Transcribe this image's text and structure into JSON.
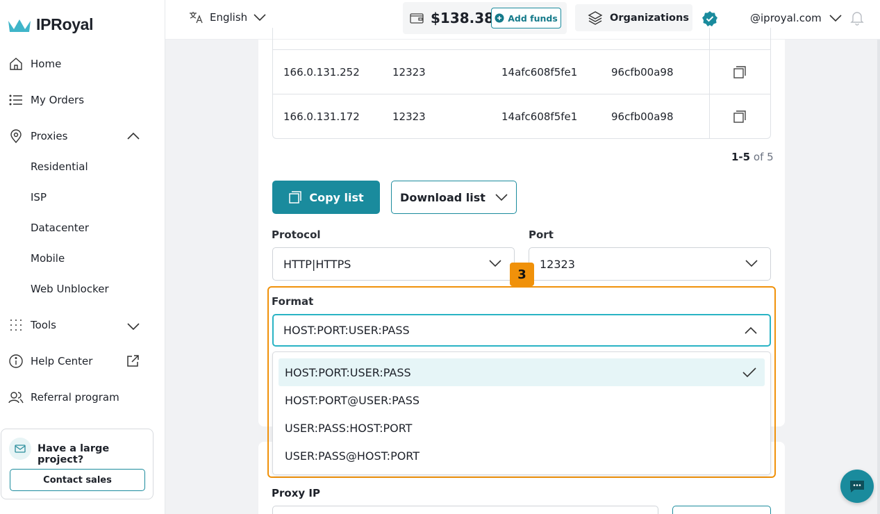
{
  "brand": {
    "name": "IPRoyal",
    "accent": "#1a8b9d",
    "highlight": "#f0910a"
  },
  "header": {
    "language": "English",
    "balance": "$138.38",
    "add_funds": "Add funds",
    "organizations": "Organizations",
    "email": "@iproyal.com"
  },
  "sidebar": {
    "home": "Home",
    "my_orders": "My Orders",
    "proxies": "Proxies",
    "proxy_items": [
      "Residential",
      "ISP",
      "Datacenter",
      "Mobile",
      "Web Unblocker"
    ],
    "tools": "Tools",
    "help_center": "Help Center",
    "referral": "Referral program",
    "promo_title": "Have a large project?",
    "promo_button": "Contact sales"
  },
  "table": {
    "rows": [
      {
        "ip": "166.0.131.252",
        "port": "12323",
        "user": "14afc608f5fe1",
        "pass": "96cfb00a98"
      },
      {
        "ip": "166.0.131.172",
        "port": "12323",
        "user": "14afc608f5fe1",
        "pass": "96cfb00a98"
      }
    ],
    "pager_range": "1-5",
    "pager_of": "of 5"
  },
  "actions": {
    "copy_list": "Copy list",
    "download_list": "Download list"
  },
  "form": {
    "protocol_label": "Protocol",
    "protocol_value": "HTTP|HTTPS",
    "port_label": "Port",
    "port_value": "12323",
    "format_label": "Format",
    "format_value": "HOST:PORT:USER:PASS",
    "format_options": [
      "HOST:PORT:USER:PASS",
      "HOST:PORT@USER:PASS",
      "USER:PASS:HOST:PORT",
      "USER:PASS@HOST:PORT"
    ],
    "proxy_ip_label": "Proxy IP"
  },
  "annotation": {
    "step": "3"
  }
}
